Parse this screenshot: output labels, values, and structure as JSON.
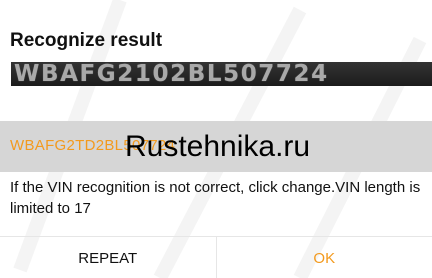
{
  "dialog": {
    "title": "Recognize result",
    "recognized_vin_image_text": "WBAFG2102BL507724",
    "vin_field_value": "WBAFG2TD2BL507724",
    "watermark_text": "Rustehnika.ru",
    "hint_text": "If the VIN recognition is not correct, click change.VIN length is limited to 17",
    "repeat_label": "REPEAT",
    "ok_label": "OK"
  },
  "colors": {
    "accent": "#f39a1e",
    "field_background": "#d6d6d6",
    "vin_image_background": "#262626"
  }
}
